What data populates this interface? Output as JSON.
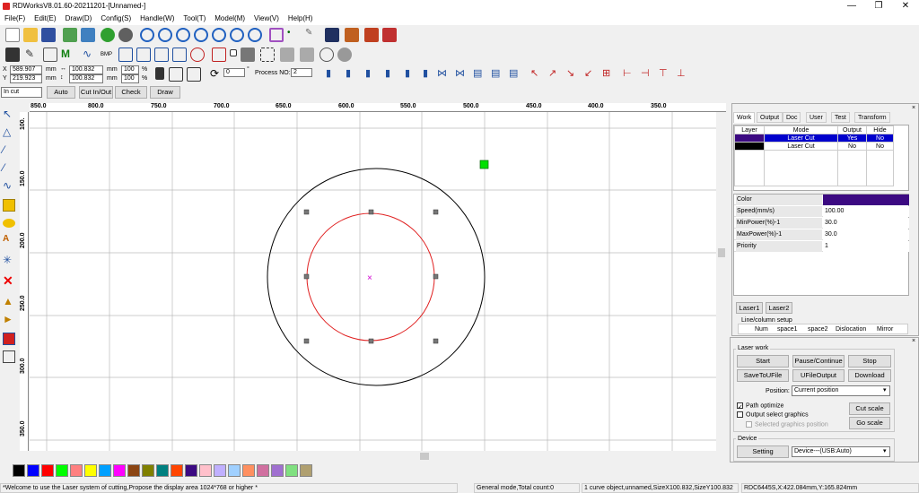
{
  "app": {
    "title": "RDWorksV8.01.60-20211201-[Unnamed-]"
  },
  "menu": [
    "File(F)",
    "Edit(E)",
    "Draw(D)",
    "Config(S)",
    "Handle(W)",
    "Tool(T)",
    "Model(M)",
    "View(V)",
    "Help(H)"
  ],
  "position": {
    "x_label": "X",
    "y_label": "Y",
    "x": "589.907",
    "y": "219.923",
    "unit": "mm",
    "w": "100.832",
    "h": "100.832",
    "sx": "100",
    "sy": "100",
    "pct": "%"
  },
  "rotation": {
    "value": "0",
    "unit": "°"
  },
  "process": {
    "label": "Process NO:",
    "value": "2"
  },
  "row3": {
    "mode": "In cut",
    "auto": "Auto",
    "cut_in_out": "Cut In/Out",
    "check": "Check",
    "draw": "Draw"
  },
  "ruler_h": [
    "850.0",
    "800.0",
    "750.0",
    "700.0",
    "650.0",
    "600.0",
    "550.0",
    "500.0",
    "450.0",
    "400.0",
    "350.0"
  ],
  "ruler_v": [
    "100.",
    "150.0",
    "200.0",
    "250.0",
    "300.0",
    "350.0"
  ],
  "tabs": [
    "Work",
    "Output",
    "Doc",
    "User",
    "Test",
    "Transform"
  ],
  "layer_table": {
    "headers": [
      "Layer",
      "Mode",
      "Output",
      "Hide"
    ],
    "rows": [
      {
        "color": "#3c0a82",
        "mode": "Laser Cut",
        "output": "Yes",
        "hide": "No"
      },
      {
        "color": "#000000",
        "mode": "Laser Cut",
        "output": "No",
        "hide": "No"
      }
    ]
  },
  "props": [
    {
      "k": "Color",
      "v": "",
      "color": "#3c0a82"
    },
    {
      "k": "Speed(mm/s)",
      "v": "100.00"
    },
    {
      "k": "MinPower(%)-1",
      "v": "30.0"
    },
    {
      "k": "MaxPower(%)-1",
      "v": "30.0"
    },
    {
      "k": "Priority",
      "v": "1"
    }
  ],
  "laser_tabs": [
    "Laser1",
    "Laser2"
  ],
  "line_col": {
    "title": "Line/column setup",
    "cols": [
      "Num",
      "space1",
      "space2",
      "Dislocation",
      "Mirror"
    ]
  },
  "laser_work": {
    "title": "Laser work",
    "start": "Start",
    "pause": "Pause/Continue",
    "stop": "Stop",
    "save": "SaveToUFile",
    "ufile": "UFileOutput",
    "download": "Download",
    "position_label": "Position:",
    "position_value": "Current position",
    "path_optimize": "Path optimize",
    "output_select": "Output select graphics",
    "selected_pos": "Selected graphics position",
    "cut_scale": "Cut scale",
    "go_scale": "Go scale"
  },
  "device": {
    "title": "Device",
    "setting": "Setting",
    "value": "Device---(USB:Auto)"
  },
  "palette": [
    "#000000",
    "#0000ff",
    "#ff0000",
    "#00ff00",
    "#ff8080",
    "#ffff00",
    "#00a0ff",
    "#ff00ff",
    "#8b4513",
    "#808000",
    "#008080",
    "#ff4500",
    "#3c0a82",
    "#ffc0cb",
    "#c0b0ff",
    "#a0d0ff",
    "#ff9060",
    "#d070a0",
    "#a070d0",
    "#80e080",
    "#b0a070"
  ],
  "status": {
    "welcome": "*Welcome to use the Laser system of cutting,Propose the display area 1024*768 or higher *",
    "mode": "General mode,Total count:0",
    "object": "1 curve object,unnamed,SizeX100.832,SizeY100.832",
    "coords": "RDC6445S,X:422.084mm,Y:165.824mm"
  }
}
